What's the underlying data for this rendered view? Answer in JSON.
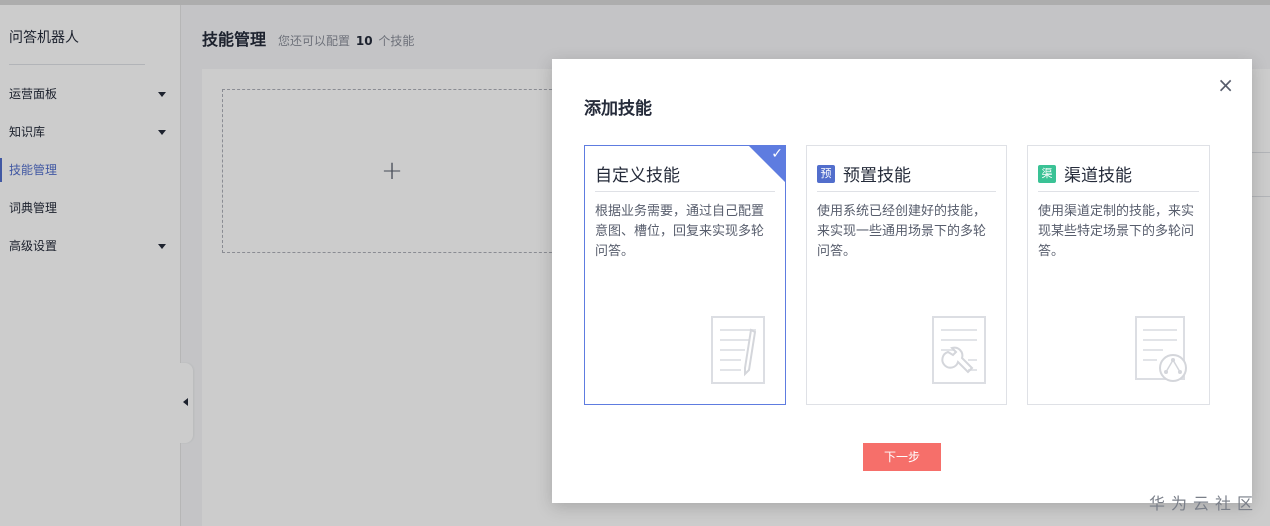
{
  "sidebar": {
    "title": "问答机器人",
    "items": [
      {
        "label": "运营面板",
        "has_arrow": true
      },
      {
        "label": "知识库",
        "has_arrow": true
      },
      {
        "label": "技能管理",
        "active": true
      },
      {
        "label": "词典管理"
      },
      {
        "label": "高级设置",
        "has_arrow": true
      }
    ]
  },
  "header": {
    "title": "技能管理",
    "subtitle_prefix": "您还可以配置",
    "count": "10",
    "subtitle_suffix": "个技能"
  },
  "main": {
    "add_card_icon": "+"
  },
  "modal": {
    "title": "添加技能",
    "close_icon": "×",
    "cards": [
      {
        "title": "自定义技能",
        "description": "根据业务需要，通过自己配置意图、槽位，回复来实现多轮问答。",
        "selected": true,
        "icon": "document-pen-icon"
      },
      {
        "badge": "预",
        "badge_color": "#526ecc",
        "title": "预置技能",
        "description": "使用系统已经创建好的技能，来实现一些通用场景下的多轮问答。",
        "icon": "document-wrench-icon"
      },
      {
        "badge": "渠",
        "badge_color": "#3ac295",
        "title": "渠道技能",
        "description": "使用渠道定制的技能，来实现某些特定场景下的多轮问答。",
        "icon": "document-share-icon"
      }
    ],
    "next_button": "下一步"
  },
  "colors": {
    "accent": "#5e7ce0",
    "primary_button": "#f66f6a"
  },
  "watermark": "华为云社区"
}
